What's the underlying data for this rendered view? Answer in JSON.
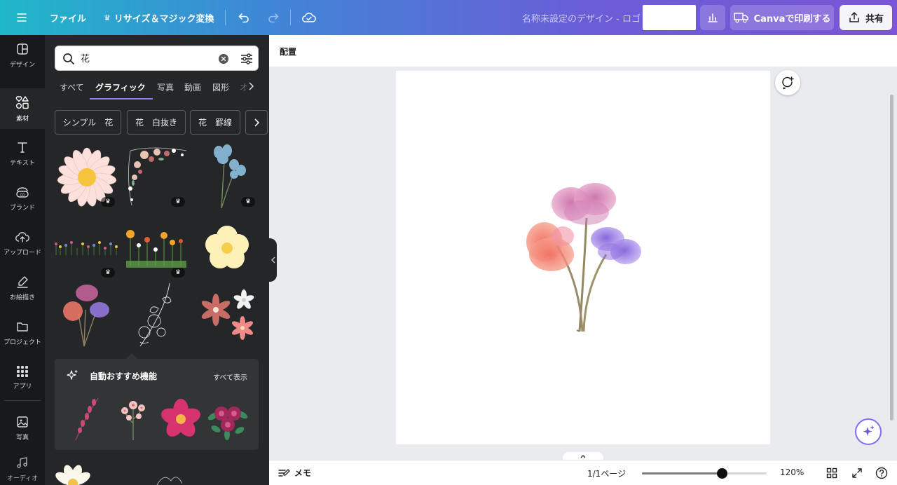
{
  "topbar": {
    "menu_icon": "hamburger-icon",
    "file_label": "ファイル",
    "resize_label": "リサイズ＆マジック変換",
    "undo_icon": "undo-icon",
    "redo_icon": "redo-icon",
    "cloud_icon": "cloud-check-icon",
    "design_title": "名称未設定のデザイン - ロゴ",
    "stats_icon": "bar-chart-icon",
    "print_label": "Canvaで印刷する",
    "share_label": "共有",
    "colors": {
      "gradient_start": "#1fb8c9",
      "gradient_end": "#7b55d6"
    }
  },
  "rail": {
    "items": [
      {
        "label": "デザイン",
        "icon": "layout-icon"
      },
      {
        "label": "素材",
        "icon": "shapes-icon"
      },
      {
        "label": "テキスト",
        "icon": "text-icon"
      },
      {
        "label": "ブランド",
        "icon": "brand-icon"
      },
      {
        "label": "アップロード",
        "icon": "upload-cloud-icon"
      },
      {
        "label": "お絵描き",
        "icon": "draw-icon"
      },
      {
        "label": "プロジェクト",
        "icon": "folder-icon"
      },
      {
        "label": "アプリ",
        "icon": "apps-grid-icon"
      },
      {
        "label": "写真",
        "icon": "photo-icon"
      },
      {
        "label": "オーディオ",
        "icon": "music-icon"
      }
    ],
    "active_index": 1
  },
  "panel": {
    "search": {
      "value": "花"
    },
    "tabs": [
      "すべて",
      "グラフィック",
      "写真",
      "動画",
      "図形",
      "オ"
    ],
    "active_tab": "グラフィック",
    "chips": [
      "シンプル　花",
      "花　白抜き",
      "花　罫線"
    ],
    "recommend": {
      "title": "自動おすすめ機能",
      "see_all": "すべて表示"
    },
    "crown_glyph": "♛"
  },
  "canvas": {
    "subbar_label": "配置"
  },
  "bottombar": {
    "notes_label": "メモ",
    "page_label": "1/1ページ",
    "zoom_label": "120%",
    "zoom_fraction": 0.64
  }
}
